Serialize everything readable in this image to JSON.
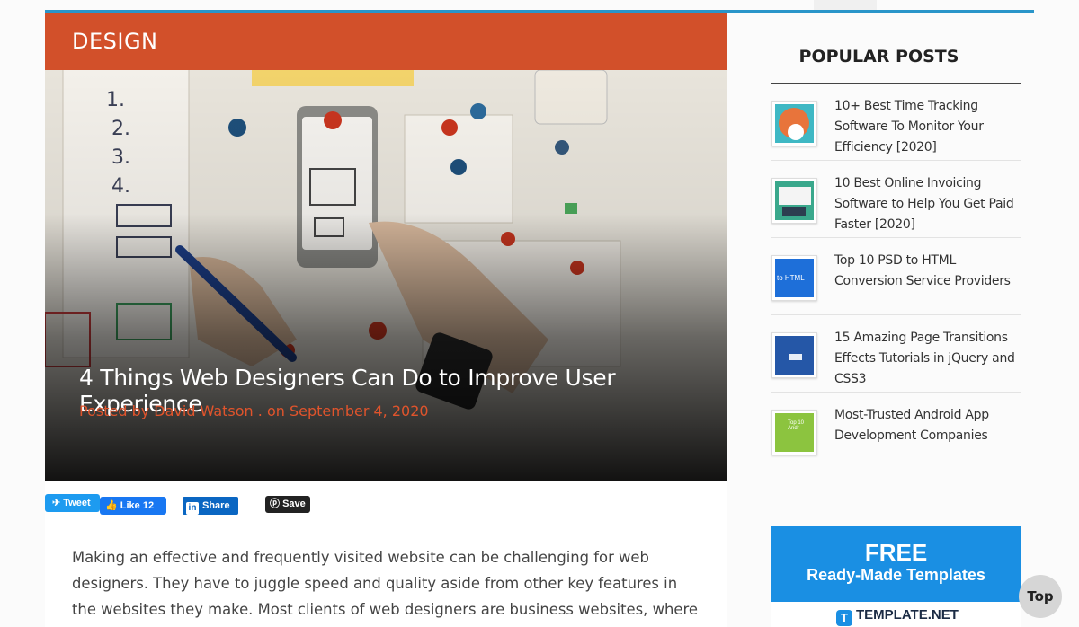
{
  "category": "DESIGN",
  "article": {
    "title": "4 Things Web Designers Can Do to Improve User Experience",
    "meta": "Posted by David Watson . on September 4, 2020",
    "body": "Making an effective and frequently visited website can be challenging for web designers. They have to juggle speed and quality aside from other key features in the websites they make. Most clients of web designers are business websites, where they face a tough challenge of not only"
  },
  "share": {
    "tweet_label": "Tweet",
    "like_label": "Like",
    "like_count": "12",
    "share_label": "Share",
    "save_label": "Save"
  },
  "sidebar": {
    "heading": "POPULAR POSTS",
    "posts": [
      {
        "title": "10+ Best Time Tracking Software To Monitor Your Efficiency [2020]",
        "thumb": "time-tracking"
      },
      {
        "title": "10 Best Online Invoicing Software to Help You Get Paid Faster [2020]",
        "thumb": "invoicing"
      },
      {
        "title": "Top 10 PSD to HTML Conversion Service Providers",
        "thumb": "psd-html",
        "thumb_text": "to HTML"
      },
      {
        "title": "15 Amazing Page Transitions Effects Tutorials in jQuery and CSS3",
        "thumb": "page-transitions"
      },
      {
        "title": "Most-Trusted Android App Development Companies",
        "thumb": "android",
        "thumb_text": "Top 10 Andr"
      }
    ]
  },
  "ad": {
    "free": "FREE",
    "subtitle": "Ready-Made Templates",
    "logo_text": "TEMPLATE.NET"
  },
  "back_to_top": "Top",
  "colors": {
    "accent_orange": "#d2502a",
    "meta_orange": "#e0542c",
    "top_line_blue": "#2a95c9",
    "ad_blue": "#1a8fe3"
  }
}
